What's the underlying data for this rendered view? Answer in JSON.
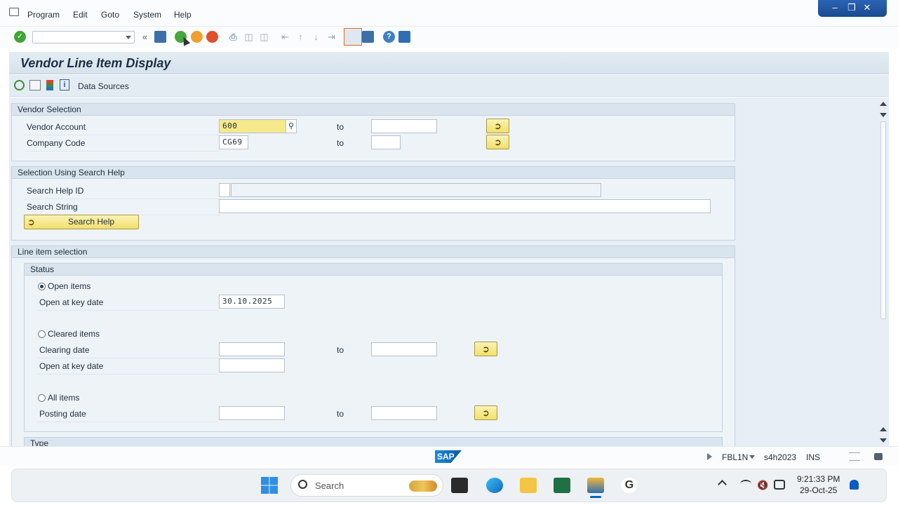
{
  "menu": {
    "items": [
      "Program",
      "Edit",
      "Goto",
      "System",
      "Help"
    ]
  },
  "toolbar": {
    "command_value": "",
    "icons": [
      "enter-icon",
      "back-arrows-icon",
      "save-icon",
      "back-icon",
      "exit-icon",
      "cancel-icon",
      "print-icon",
      "find-icon",
      "find-next-icon",
      "first-page-icon",
      "previous-page-icon",
      "next-page-icon",
      "last-page-icon",
      "create-session-icon",
      "shortcut-icon",
      "help-icon",
      "customize-layout-icon"
    ]
  },
  "title": "Vendor Line Item Display",
  "app_toolbar": {
    "data_sources": "Data Sources"
  },
  "vendor_selection": {
    "title": "Vendor Selection",
    "vendor_account_label": "Vendor Account",
    "vendor_account_value": "600",
    "company_code_label": "Company Code",
    "company_code_value": "CG69",
    "to": "to"
  },
  "search_help": {
    "title": "Selection Using Search Help",
    "search_help_id_label": "Search Help ID",
    "search_string_label": "Search String",
    "button_label": "Search Help"
  },
  "line_item": {
    "title": "Line item selection",
    "status_title": "Status",
    "open_items": "Open items",
    "open_at_key_date": "Open at key date",
    "open_key_date_value": "30.10.2025",
    "cleared_items": "Cleared items",
    "clearing_date": "Clearing date",
    "cleared_open_at_key_date": "Open at key date",
    "all_items": "All items",
    "posting_date": "Posting date",
    "to": "to",
    "type_title": "Type"
  },
  "status_bar": {
    "sap_logo": "SAP",
    "transaction": "FBL1N",
    "system": "s4h2023",
    "mode": "INS"
  },
  "taskbar": {
    "search_placeholder": "Search",
    "time": "9:21:33 PM",
    "date": "29-Oct-25"
  }
}
